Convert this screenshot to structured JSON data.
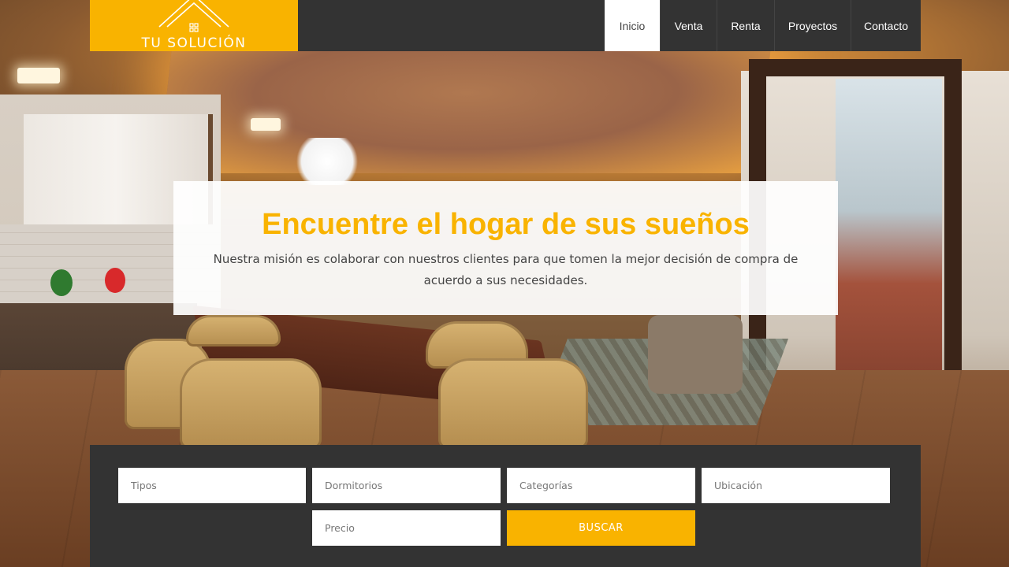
{
  "brand": {
    "name": "TU SOLUCIÓN",
    "color": "#f9b300"
  },
  "nav": {
    "items": [
      {
        "label": "Inicio",
        "active": true
      },
      {
        "label": "Venta",
        "active": false
      },
      {
        "label": "Renta",
        "active": false
      },
      {
        "label": "Proyectos",
        "active": false
      },
      {
        "label": "Contacto",
        "active": false
      }
    ]
  },
  "hero": {
    "title": "Encuentre el hogar de sus sueños",
    "subtitle": "Nuestra misión es colaborar con nuestros clientes para que tomen la mejor decisión de compra de acuerdo a sus necesidades."
  },
  "search": {
    "types_placeholder": "Tipos",
    "bedrooms_placeholder": "Dormitorios",
    "categories_placeholder": "Categorías",
    "location_placeholder": "Ubicación",
    "price_placeholder": "Precio",
    "button_label": "BUSCAR"
  },
  "icons": {
    "logo": "house-roof-icon"
  }
}
